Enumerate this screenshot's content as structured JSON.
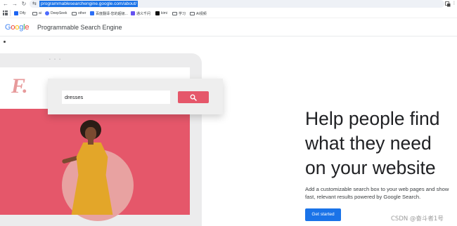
{
  "browser": {
    "url": "programmablesearchengine.google.com/about/",
    "nav": {
      "back_glyph": "←",
      "forward_glyph": "→",
      "reload_glyph": "↻",
      "site_info_glyph": "⇆"
    },
    "bookmarks": [
      {
        "label": "Dify",
        "icon": "dify-icon",
        "color": "#1c64f2"
      },
      {
        "label": "ai",
        "icon": "folder-icon"
      },
      {
        "label": "DeepSeek",
        "icon": "deepseek-icon",
        "color": "#4d6bfe"
      },
      {
        "label": "other",
        "icon": "folder-icon"
      },
      {
        "label": "百度翻译-您的超级...",
        "icon": "baidu-translate-icon",
        "color": "#2b6ef5"
      },
      {
        "label": "通义千问",
        "icon": "tongyi-icon",
        "color": "#6552f0"
      },
      {
        "label": "kimi",
        "icon": "kimi-icon",
        "color": "#111111"
      },
      {
        "label": "学习",
        "icon": "folder-icon"
      },
      {
        "label": "AI视频",
        "icon": "folder-icon"
      }
    ]
  },
  "site": {
    "logo_letters": [
      "G",
      "o",
      "o",
      "g",
      "l",
      "e"
    ],
    "logo_colors": [
      "#4285f4",
      "#ea4335",
      "#fbbc05",
      "#4285f4",
      "#34a853",
      "#ea4335"
    ],
    "title": "Programmable Search Engine"
  },
  "hero": {
    "illustration": {
      "brand_letter": "F.",
      "search_value": "dresses",
      "accent_color": "#e5576a"
    },
    "headline": "Help people find what they need on your website",
    "description": "Add a customizable search box to your web pages and show fast, relevant results powered by Google Search.",
    "cta_label": "Get started",
    "cta_color": "#1a73e8"
  },
  "watermark": "CSDN @奋斗者1号"
}
